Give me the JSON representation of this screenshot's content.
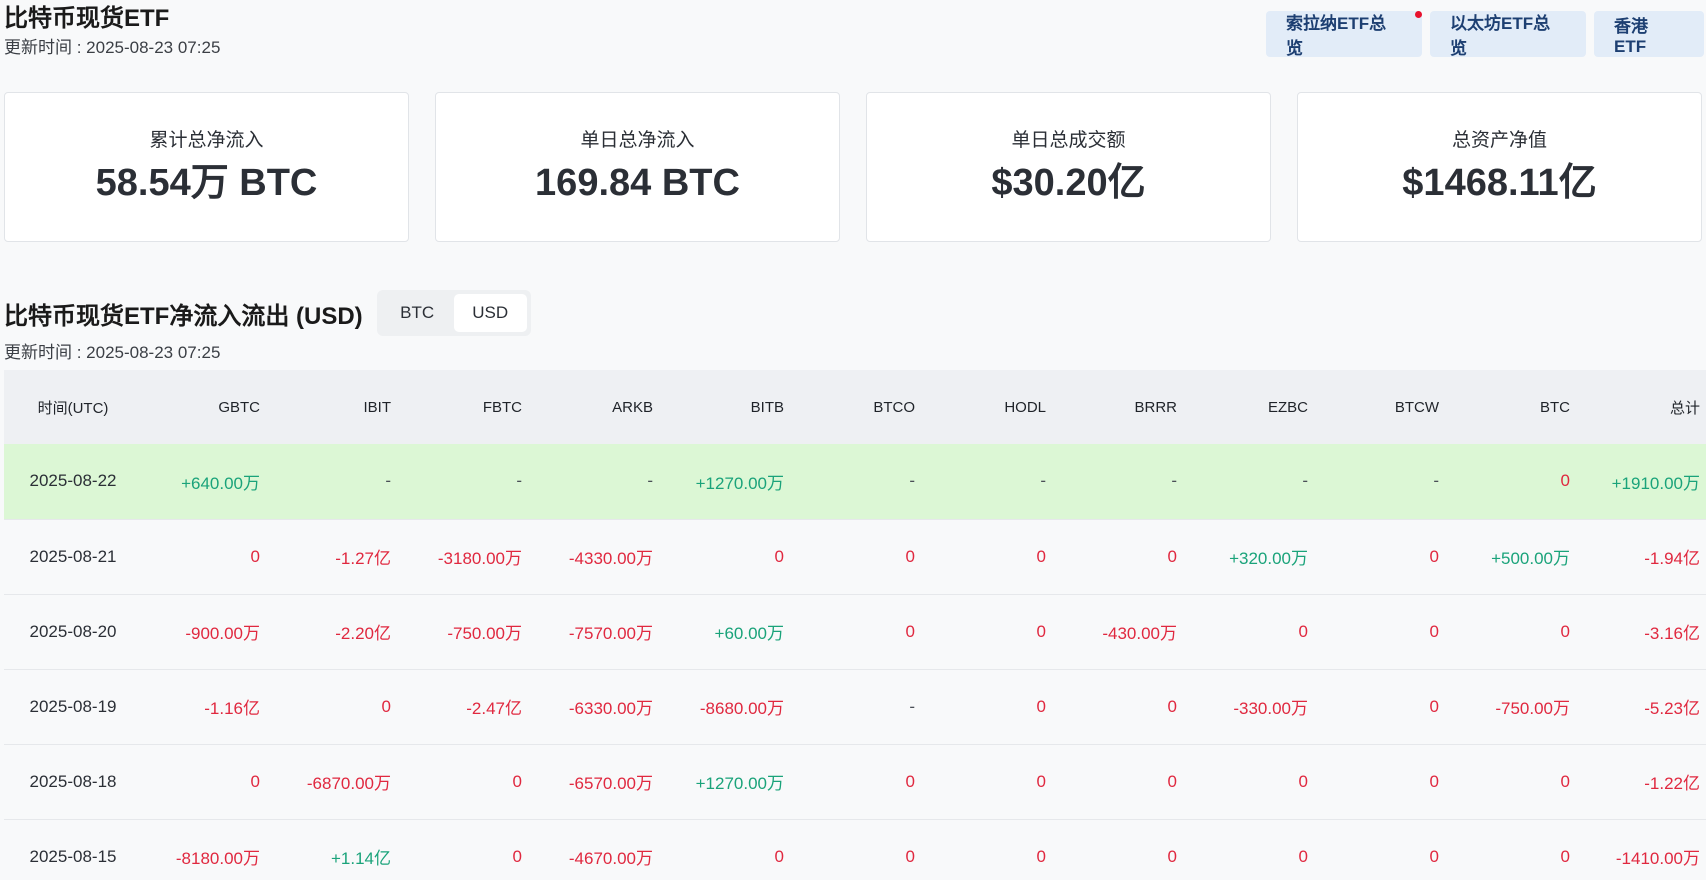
{
  "header": {
    "title": "比特币现货ETF",
    "update_time": "更新时间 : 2025-08-23 07:25"
  },
  "nav": {
    "solana": "索拉纳ETF总览",
    "ethereum": "以太坊ETF总览",
    "hongkong": "香港 ETF"
  },
  "colors": {
    "positive": "#1aa37a",
    "negative": "#e0283f",
    "highlight_row": "#dcf7d5",
    "nav_button": "#e2ecf8",
    "notification_dot": "#e8112d"
  },
  "stats": [
    {
      "label": "累计总净流入",
      "value": "58.54万 BTC"
    },
    {
      "label": "单日总净流入",
      "value": "169.84 BTC"
    },
    {
      "label": "单日总成交额",
      "value": "$30.20亿"
    },
    {
      "label": "总资产净值",
      "value": "$1468.11亿"
    }
  ],
  "flows": {
    "title": "比特币现货ETF净流入流出 (USD)",
    "update_time": "更新时间 : 2025-08-23 07:25",
    "toggle": {
      "btc": "BTC",
      "usd": "USD",
      "selected": "USD"
    },
    "columns": [
      "时间(UTC)",
      "GBTC",
      "IBIT",
      "FBTC",
      "ARKB",
      "BITB",
      "BTCO",
      "HODL",
      "BRRR",
      "EZBC",
      "BTCW",
      "BTC",
      "总计"
    ],
    "rows": [
      {
        "date": "2025-08-22",
        "highlight": true,
        "cells": [
          {
            "v": "+640.00万",
            "t": "pos"
          },
          {
            "v": "-",
            "t": "na"
          },
          {
            "v": "-",
            "t": "na"
          },
          {
            "v": "-",
            "t": "na"
          },
          {
            "v": "+1270.00万",
            "t": "pos"
          },
          {
            "v": "-",
            "t": "na"
          },
          {
            "v": "-",
            "t": "na"
          },
          {
            "v": "-",
            "t": "na"
          },
          {
            "v": "-",
            "t": "na"
          },
          {
            "v": "-",
            "t": "na"
          },
          {
            "v": "0",
            "t": "neg"
          },
          {
            "v": "+1910.00万",
            "t": "pos"
          }
        ]
      },
      {
        "date": "2025-08-21",
        "highlight": false,
        "cells": [
          {
            "v": "0",
            "t": "neg"
          },
          {
            "v": "-1.27亿",
            "t": "neg"
          },
          {
            "v": "-3180.00万",
            "t": "neg"
          },
          {
            "v": "-4330.00万",
            "t": "neg"
          },
          {
            "v": "0",
            "t": "neg"
          },
          {
            "v": "0",
            "t": "neg"
          },
          {
            "v": "0",
            "t": "neg"
          },
          {
            "v": "0",
            "t": "neg"
          },
          {
            "v": "+320.00万",
            "t": "pos"
          },
          {
            "v": "0",
            "t": "neg"
          },
          {
            "v": "+500.00万",
            "t": "pos"
          },
          {
            "v": "-1.94亿",
            "t": "neg"
          }
        ]
      },
      {
        "date": "2025-08-20",
        "highlight": false,
        "cells": [
          {
            "v": "-900.00万",
            "t": "neg"
          },
          {
            "v": "-2.20亿",
            "t": "neg"
          },
          {
            "v": "-750.00万",
            "t": "neg"
          },
          {
            "v": "-7570.00万",
            "t": "neg"
          },
          {
            "v": "+60.00万",
            "t": "pos"
          },
          {
            "v": "0",
            "t": "neg"
          },
          {
            "v": "0",
            "t": "neg"
          },
          {
            "v": "-430.00万",
            "t": "neg"
          },
          {
            "v": "0",
            "t": "neg"
          },
          {
            "v": "0",
            "t": "neg"
          },
          {
            "v": "0",
            "t": "neg"
          },
          {
            "v": "-3.16亿",
            "t": "neg"
          }
        ]
      },
      {
        "date": "2025-08-19",
        "highlight": false,
        "cells": [
          {
            "v": "-1.16亿",
            "t": "neg"
          },
          {
            "v": "0",
            "t": "neg"
          },
          {
            "v": "-2.47亿",
            "t": "neg"
          },
          {
            "v": "-6330.00万",
            "t": "neg"
          },
          {
            "v": "-8680.00万",
            "t": "neg"
          },
          {
            "v": "-",
            "t": "na"
          },
          {
            "v": "0",
            "t": "neg"
          },
          {
            "v": "0",
            "t": "neg"
          },
          {
            "v": "-330.00万",
            "t": "neg"
          },
          {
            "v": "0",
            "t": "neg"
          },
          {
            "v": "-750.00万",
            "t": "neg"
          },
          {
            "v": "-5.23亿",
            "t": "neg"
          }
        ]
      },
      {
        "date": "2025-08-18",
        "highlight": false,
        "cells": [
          {
            "v": "0",
            "t": "neg"
          },
          {
            "v": "-6870.00万",
            "t": "neg"
          },
          {
            "v": "0",
            "t": "neg"
          },
          {
            "v": "-6570.00万",
            "t": "neg"
          },
          {
            "v": "+1270.00万",
            "t": "pos"
          },
          {
            "v": "0",
            "t": "neg"
          },
          {
            "v": "0",
            "t": "neg"
          },
          {
            "v": "0",
            "t": "neg"
          },
          {
            "v": "0",
            "t": "neg"
          },
          {
            "v": "0",
            "t": "neg"
          },
          {
            "v": "0",
            "t": "neg"
          },
          {
            "v": "-1.22亿",
            "t": "neg"
          }
        ]
      },
      {
        "date": "2025-08-15",
        "highlight": false,
        "cells": [
          {
            "v": "-8180.00万",
            "t": "neg"
          },
          {
            "v": "+1.14亿",
            "t": "pos"
          },
          {
            "v": "0",
            "t": "neg"
          },
          {
            "v": "-4670.00万",
            "t": "neg"
          },
          {
            "v": "0",
            "t": "neg"
          },
          {
            "v": "0",
            "t": "neg"
          },
          {
            "v": "0",
            "t": "neg"
          },
          {
            "v": "0",
            "t": "neg"
          },
          {
            "v": "0",
            "t": "neg"
          },
          {
            "v": "0",
            "t": "neg"
          },
          {
            "v": "0",
            "t": "neg"
          },
          {
            "v": "-1410.00万",
            "t": "neg"
          }
        ]
      }
    ]
  }
}
